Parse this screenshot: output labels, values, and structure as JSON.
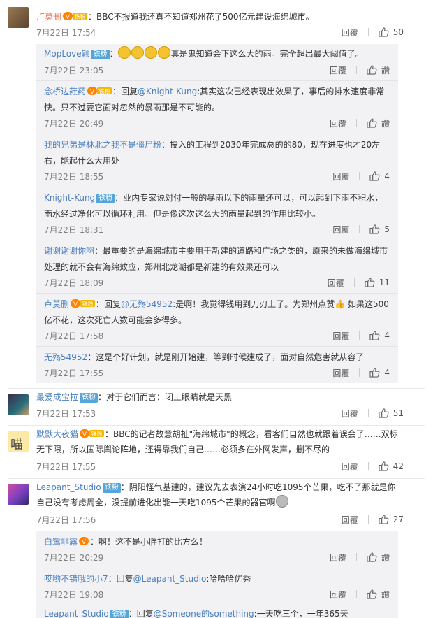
{
  "ui": {
    "reply": "回覆",
    "like": "讚",
    "fans_badge": "铁粉"
  },
  "comments": [
    {
      "user": "卢莫删",
      "badge": "",
      "vip": true,
      "text": "BBC不报道我还真不知道郑州花了500亿元建设海绵城市。",
      "time": "7月22日 17:54",
      "likes": "50",
      "replies": [
        {
          "user": "MopLove颖",
          "badge": "铁粉",
          "vip": false,
          "emojis": 4,
          "mention": "",
          "text": "真是鬼知道会下这么大的雨。完全超出最大阈值了。",
          "time": "7月22日 23:05",
          "likes": "讚"
        },
        {
          "user": "念桥边荭药",
          "badge": "",
          "vip": true,
          "mention": "@Knight-Kung",
          "text": "其实这次已经表现出效果了，事后的排水速度非常快。只不过要它面对忽然的暴雨那是不可能的。",
          "time": "7月22日 20:49",
          "likes": "讚"
        },
        {
          "user": "我的兄弟是林北之我不是僵尸粉",
          "badge": "",
          "vip": false,
          "mention": "",
          "text": "投入的工程到2030年完成总的的80，现在进度也才20左右，能起什么大用处",
          "time": "7月22日 18:55",
          "likes": "4"
        },
        {
          "user": "Knight-Kung",
          "badge": "铁粉",
          "vip": false,
          "mention": "",
          "text": "业内专家说对付一般的暴雨以下的雨量还可以，可以起到下雨不积水，雨水经过净化可以循环利用。但是像这次这么大的雨量起到的作用比较小。",
          "time": "7月22日 18:31",
          "likes": "5"
        },
        {
          "user": "谢谢谢谢你啊",
          "badge": "",
          "vip": false,
          "mention": "",
          "text": "最重要的是海绵城市主要用于新建的道路和广场之类的，原来的未做海绵城市处理的就不会有海绵效应，郑州北龙湖都是新建的有效果还可以",
          "time": "7月22日 18:09",
          "likes": "11"
        },
        {
          "user": "卢莫删",
          "badge": "",
          "vip": true,
          "mention": "@无殇54952",
          "text": "是啊！我觉得钱用到刀刃上了。为郑州点赞👍 如果这500亿不花，这次死亡人数可能会多得多。",
          "time": "7月22日 17:58",
          "likes": "4"
        },
        {
          "user": "无殇54952",
          "badge": "",
          "vip": false,
          "mention": "",
          "text": "这是个好计划，就是刚开始建，等到时候建成了，面对自然危害就从容了",
          "time": "7月22日 17:55",
          "likes": "4"
        }
      ]
    },
    {
      "user": "最爱成宝拉",
      "badge": "铁粉",
      "vip": false,
      "text": "对于它们而言：闭上眼睛就是天黑",
      "time": "7月22日 17:53",
      "likes": "51",
      "replies": []
    },
    {
      "user": "默默大夜猫",
      "badge": "",
      "vip": true,
      "text": "BBC的记者故意胡扯\"海绵城市\"的概念，看客们自然也就跟着误会了……双标无下限，所以国际舆论阵地，还得靠我们自己……必须多在外网发声，删不尽的",
      "time": "7月22日 17:55",
      "likes": "42",
      "replies": []
    },
    {
      "user": "Leapant_Studio",
      "badge": "铁粉",
      "vip": false,
      "text": "阴阳怪气基建的，建议先去表演24小时吃1095个芒果，吃不了那就是你自己没有考虑周全，没提前进化出能一天吃1095个芒果的器官啊",
      "time": "7月22日 17:56",
      "likes": "27",
      "replies": [
        {
          "user": "白鹭非露",
          "badge": "",
          "vip": true,
          "mention": "",
          "text": "啊！这不是小胖打的比方么！",
          "time": "7月22日 20:29",
          "likes": "讚"
        },
        {
          "user": "哎哟不错哦的小7",
          "badge": "",
          "vip": false,
          "mention": "@Leapant_Studio",
          "text": "哈哈哈优秀",
          "time": "7月22日 19:08",
          "likes": "讚"
        },
        {
          "user": "Leapant_Studio",
          "badge": "铁粉",
          "vip": false,
          "mention": "@Someone的something",
          "text": "一天吃三个，一年365天",
          "time": "",
          "likes": ""
        }
      ]
    }
  ]
}
